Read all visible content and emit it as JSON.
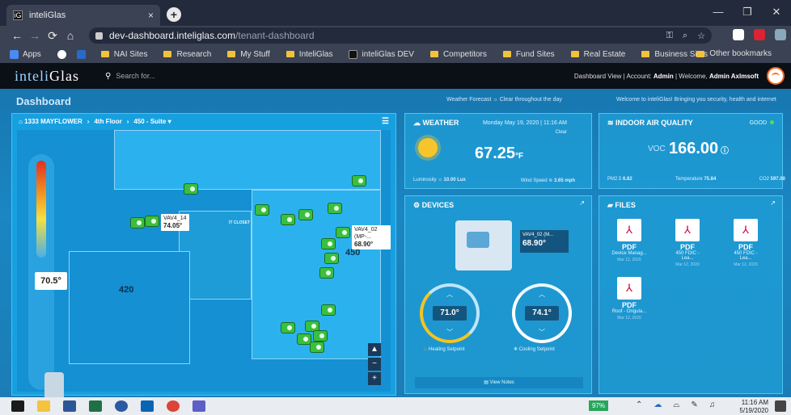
{
  "browser": {
    "tab_title": "inteliGlas",
    "tab_favicon": "iG",
    "tab_close": "×",
    "new_tab": "+",
    "url_host": "dev-dashboard.inteliglas.com",
    "url_path": "/tenant-dashboard",
    "window_controls": {
      "minimize": "—",
      "maximize": "❐",
      "close": "✕"
    }
  },
  "bookmarks": [
    "Apps",
    "NAI Sites",
    "Research",
    "My Stuff",
    "InteliGlas",
    "inteliGlas DEV",
    "Competitors",
    "Fund Sites",
    "Real Estate",
    "Business Sites"
  ],
  "bookmarks_other": "Other bookmarks",
  "app": {
    "logo_a": "inteli",
    "logo_b": "Glas",
    "search_placeholder": "Search for...",
    "header_right_prefix": "Dashboard View  |  Account: ",
    "account": "Admin",
    "welcome_prefix": "  |  Welcome, ",
    "user": "Admin Axlmsoft"
  },
  "dashboard": {
    "title": "Dashboard",
    "weather_forecast": "Weather Forecast  ☼ Clear throughout the day",
    "welcome_text": "Welcome to inteliGlas!  Bringing you security, health and internet"
  },
  "floorplan": {
    "building": "1333 MAYFLOWER",
    "floor": "4th Floor",
    "suite": "450 - Suite",
    "current_temp": "70.5°",
    "room_420": "420",
    "room_450": "450",
    "tags": [
      {
        "name": "VAV4_14",
        "temp": "74.05°"
      },
      {
        "name": "VAV4_02 (MP-...",
        "temp": "68.90°"
      }
    ],
    "closet_label": "IT CLOSET",
    "zoom_up": "▲",
    "zoom_minus": "−",
    "zoom_plus": "+"
  },
  "weather": {
    "title": "WEATHER",
    "date": "Monday May 19, 2020  |  11:16 AM",
    "condition": "Clear",
    "temp": "67.25",
    "unit": "°F",
    "luminosity_label": "Luminosity",
    "luminosity": "10.00 Lux",
    "wind_label": "Wind Speed",
    "wind": "3.65 mph"
  },
  "air_quality": {
    "title": "INDOOR AIR QUALITY",
    "status": "GOOD",
    "voc_label": "VOC",
    "voc_value": "166.00",
    "pm25_label": "PM2.5",
    "pm25": "6.82",
    "temp_label": "Temperature",
    "temperature": "75.84",
    "co2_label": "CO2",
    "co2": "597.00"
  },
  "devices": {
    "title": "DEVICES",
    "device_name": "VAV4_02 (M...",
    "device_temp": "68.90°",
    "heating_value": "71.0°",
    "heating_label": "Heating Setpoint",
    "cooling_value": "74.1°",
    "cooling_label": "Cooling Setpoint",
    "notes": "View Notes",
    "heating_level": 0.45,
    "cooling_level": 0.95
  },
  "files": {
    "title": "FILES",
    "items": [
      {
        "type": "PDF",
        "name": "Device Manag...",
        "meta": "Mar 12, 2020"
      },
      {
        "type": "PDF",
        "name": "450 FDIC - Lea...",
        "meta": "Mar 12, 2020"
      },
      {
        "type": "PDF",
        "name": "450 FDIC - Lea...",
        "meta": "Mar 12, 2020"
      },
      {
        "type": "PDF",
        "name": "Roof - Origula...",
        "meta": "Mar 12, 2020"
      }
    ]
  },
  "taskbar": {
    "battery": "97%",
    "time": "11:16 AM",
    "date": "5/19/2020"
  },
  "colors": {
    "browser_bg": "#232a3b",
    "appbar_bg": "#0b0f16",
    "dashboard_bg": "#1a86c2",
    "device_green": "#3bbf3f",
    "heating_yellow": "#f2c522",
    "accent_orange": "#f26a21"
  }
}
